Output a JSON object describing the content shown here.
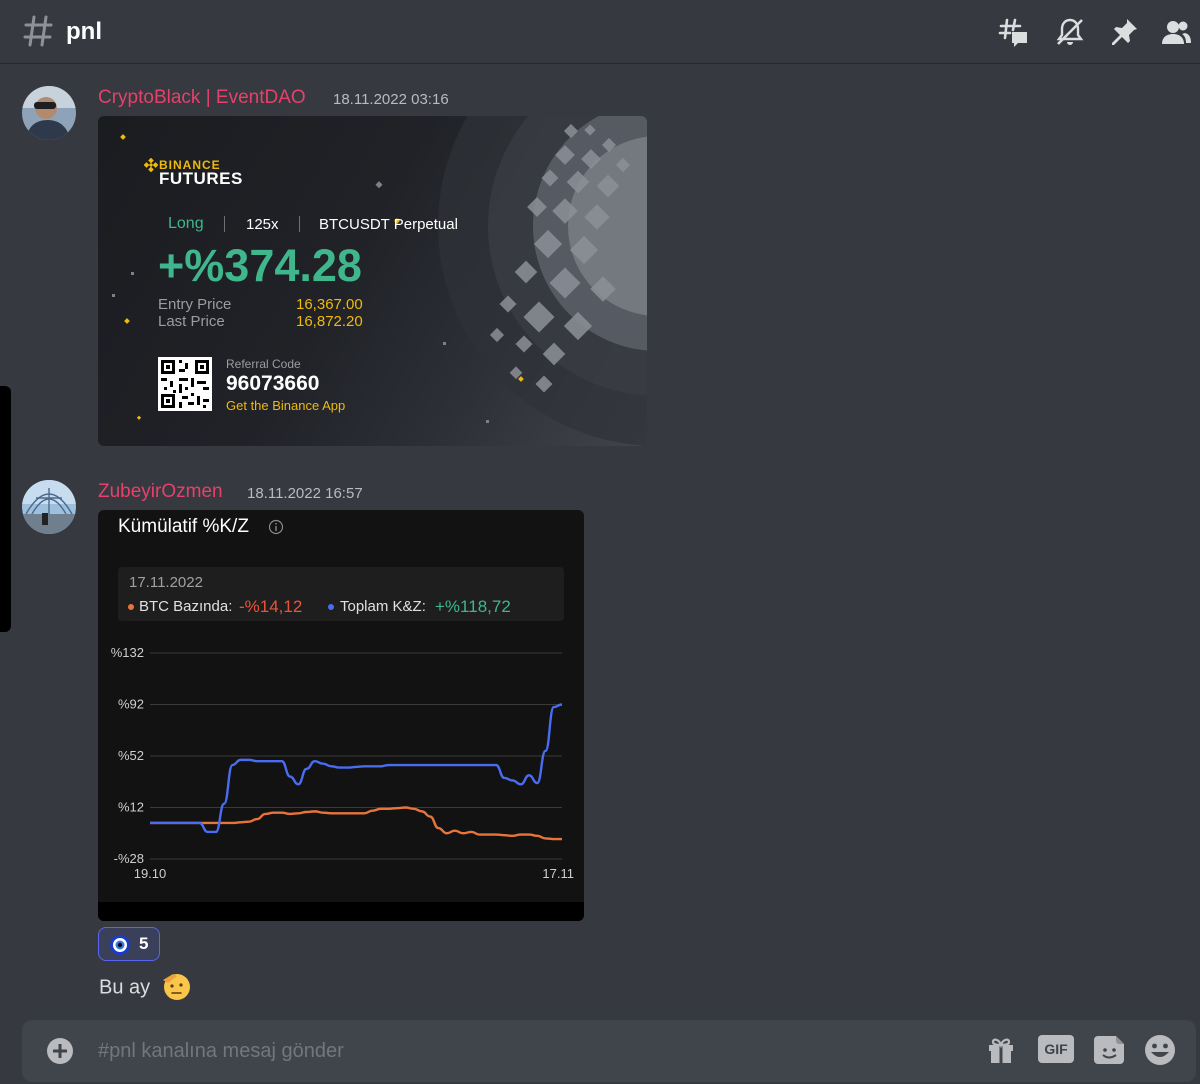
{
  "header": {
    "channel": "pnl",
    "icons": [
      "threads-icon",
      "bell-muted-icon",
      "pin-icon",
      "members-icon"
    ]
  },
  "messages": [
    {
      "author": "CryptoBlack | EventDAO",
      "timestamp": "18.11.2022 03:16",
      "card": {
        "brand_top": "BINANCE",
        "brand_bottom": "FUTURES",
        "side": "Long",
        "leverage": "125x",
        "pair": "BTCUSDT Perpetual",
        "roi": "+%374.28",
        "entry_label": "Entry Price",
        "entry_value": "16,367.00",
        "last_label": "Last Price",
        "last_value": "16,872.20",
        "referral_label": "Referral Code",
        "referral_code": "96073660",
        "app_cta": "Get the Binance App"
      }
    },
    {
      "author": "ZubeyirOzmen",
      "timestamp": "18.11.2022 16:57",
      "reaction": {
        "emoji": "nazar-amulet-icon",
        "count": "5"
      },
      "text": "Bu ay"
    }
  ],
  "chart_data": {
    "type": "line",
    "title": "Kümülatif %K/Z",
    "tooltip": {
      "date": "17.11.2022",
      "series1_label": "BTC Bazında:",
      "series1_value": "-%14,12",
      "series2_label": "Toplam K&Z:",
      "series2_value": "+%118,72"
    },
    "y_ticks": [
      "%132",
      "%92",
      "%52",
      "%12",
      "-%28"
    ],
    "y_tick_values": [
      132,
      92,
      52,
      12,
      -28
    ],
    "x_ticks": [
      "19.10",
      "17.11"
    ],
    "ylim": [
      -28,
      132
    ],
    "x": [
      0,
      2,
      4,
      6,
      8,
      10,
      12,
      14,
      16,
      18,
      20,
      22,
      24,
      26,
      28,
      30,
      32,
      34,
      36,
      38,
      40,
      42,
      44,
      46,
      48,
      50,
      52,
      54,
      56,
      58,
      60,
      62,
      64,
      66,
      68,
      70,
      72,
      74,
      76,
      78,
      80,
      82,
      84,
      86,
      88,
      90,
      92,
      94,
      96,
      98,
      100
    ],
    "series": [
      {
        "name": "BTC Bazında",
        "color": "#e8743b",
        "values": [
          0,
          0,
          0,
          0,
          0,
          0,
          0,
          0,
          0,
          0,
          0,
          0.5,
          1,
          3,
          7,
          8,
          8,
          7,
          7.5,
          8.5,
          9,
          8,
          7.5,
          7.5,
          7.5,
          7.5,
          7.5,
          9.5,
          11,
          11,
          11.5,
          12,
          11,
          9,
          5,
          -4,
          -8,
          -6,
          -8,
          -7,
          -9,
          -9,
          -9,
          -9.5,
          -10,
          -9,
          -9,
          -10,
          -12,
          -12.5,
          -12.5
        ]
      },
      {
        "name": "Toplam K&Z",
        "color": "#4a6cf0",
        "values": [
          0,
          0,
          0,
          0,
          0,
          0,
          0,
          -7,
          -7,
          15,
          45,
          49,
          49,
          48,
          48,
          48,
          48,
          36,
          30,
          42,
          48,
          46,
          44,
          43,
          43,
          43.5,
          44,
          44,
          44,
          45,
          45,
          45,
          45,
          45,
          45,
          45,
          45,
          45,
          45,
          45,
          45,
          45,
          45,
          35,
          33,
          30,
          37,
          31,
          56,
          90,
          92
        ]
      }
    ]
  },
  "composer": {
    "placeholder": "#pnl kanalına mesaj gönder",
    "icons": [
      "gift-icon",
      "gif-icon",
      "sticker-icon",
      "emoji-icon"
    ],
    "gif_label": "GIF"
  }
}
